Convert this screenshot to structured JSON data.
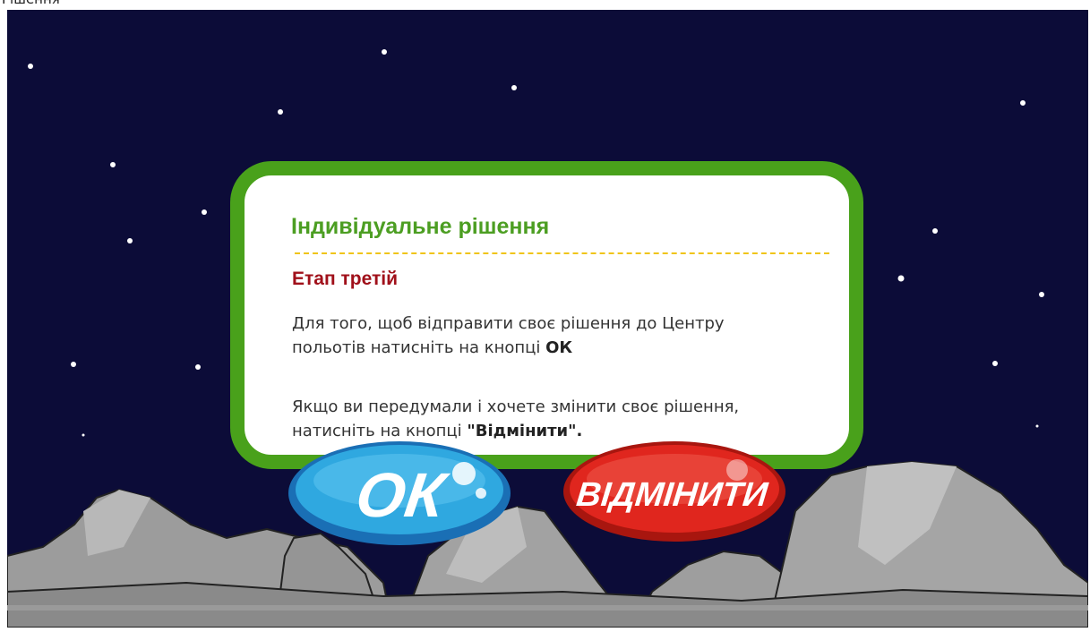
{
  "header": {
    "cut_text": "Рішення"
  },
  "dialog": {
    "title": "Індивідуальне рішення",
    "subtitle": "Етап третій",
    "paragraph1": {
      "line1": "Для того, щоб відправити своє рішення до Центру",
      "line2_prefix": "польотів натисніть на кнопці ",
      "line2_bold": "ОК"
    },
    "paragraph2": {
      "line1": "Якщо ви передумали і хочете змінити своє рішення,",
      "line2_prefix": "натисніть на кнопці ",
      "line2_bold": "\"Відмінити\"."
    }
  },
  "buttons": {
    "ok_label": "ОК",
    "cancel_label": "ВІДМІНИТИ"
  },
  "colors": {
    "sky": "#0c0c38",
    "dialog_border": "#49a11b",
    "title": "#4c9e22",
    "subtitle": "#a0101a",
    "divider": "#f0c419",
    "ok_button": "#2fa8e0",
    "cancel_button": "#e0261e",
    "rock": "#9a9a9a"
  }
}
